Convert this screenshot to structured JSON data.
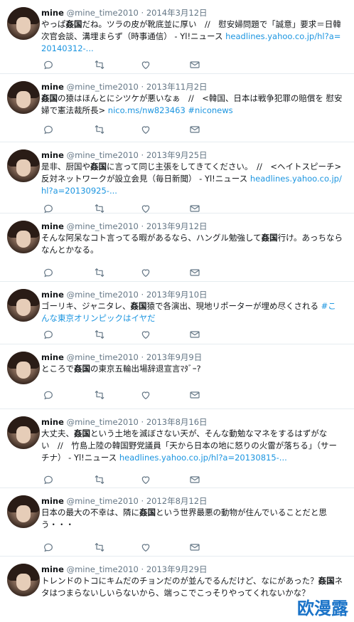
{
  "account": {
    "name": "mine",
    "handle": "@mine_time2010"
  },
  "tweets": [
    {
      "date": "2014年3月12日",
      "segments": [
        {
          "t": "やっぱ"
        },
        {
          "t": "姦国",
          "b": true
        },
        {
          "t": "だね。ツラの皮が靴底並に厚い　//　慰安婦問題で「誠意」要求＝日韓次官会談、溝埋まらず（時事通信） - Yl!ニュース "
        },
        {
          "t": "headlines.yahoo.co.jp/hl?a=20140312-...",
          "link": true
        }
      ]
    },
    {
      "date": "2013年11月2日",
      "segments": [
        {
          "t": "姦国",
          "b": true
        },
        {
          "t": "の猿はほんとにシツケが悪いなぁ　//　<韓国、日本は戦争犯罪の賠償を 慰安婦で憲法裁所長> "
        },
        {
          "t": "nico.ms/nw823463 #niconews",
          "link": true
        }
      ]
    },
    {
      "date": "2013年9月25日",
      "segments": [
        {
          "t": "是非、厨国や"
        },
        {
          "t": "姦国",
          "b": true
        },
        {
          "t": "に言って同じ主張をしてきてください。　//　<ヘイトスピーチ> 反対ネットワークが設立会見（毎日新聞） - Yl!ニュース "
        },
        {
          "t": "headlines.yahoo.co.jp/hl?a=20130925-...",
          "link": true
        }
      ]
    },
    {
      "date": "2013年9月12日",
      "segments": [
        {
          "t": "そんな阿呆なコト言ってる暇があるなら、ハングル勉強して"
        },
        {
          "t": "姦国",
          "b": true
        },
        {
          "t": "行け。あっちならなんとかなる。"
        }
      ]
    },
    {
      "date": "2013年9月10日",
      "segments": [
        {
          "t": "ゴーリキ、ジャニタレ、"
        },
        {
          "t": "姦国",
          "b": true
        },
        {
          "t": "猿で各演出、現地リポーターが埋め尽くされる "
        },
        {
          "t": "#こんな東京オリンピックはイヤだ",
          "link": true
        }
      ]
    },
    {
      "date": "2013年9月9日",
      "segments": [
        {
          "t": "ところで"
        },
        {
          "t": "姦国",
          "b": true
        },
        {
          "t": "の東京五輪出場辞退宣言ﾏﾀﾞｰ?"
        }
      ]
    },
    {
      "date": "2013年8月16日",
      "segments": [
        {
          "t": "大丈夫、"
        },
        {
          "t": "姦国",
          "b": true
        },
        {
          "t": "という土地を滅ぼさない天が、そんな動勉なマネをするはずがない　//　竹島上陸の韓国野党議員「天から日本の地に怒りの火雷が落ちる」（サーチナ） - Yl!ニュース "
        },
        {
          "t": "headlines.yahoo.co.jp/hl?a=20130815-...",
          "link": true
        }
      ]
    },
    {
      "date": "2012年8月12日",
      "segments": [
        {
          "t": "日本の最大の不幸は、隣に"
        },
        {
          "t": "姦国",
          "b": true
        },
        {
          "t": "という世界最悪の動物が住んでいることだと思う・・・"
        }
      ]
    },
    {
      "date": "2013年9月29日",
      "segments": [
        {
          "t": "トレンドのトコにキムだのチョンだのが並んでるんだけど、なにがあった？"
        },
        {
          "t": "姦国",
          "b": true
        },
        {
          "t": "ネタはつまらないしいらないから、端っこでこっそりやってくれないかな？"
        }
      ]
    }
  ],
  "dot": "·",
  "watermark": "欧漫露",
  "icons": [
    "reply-icon",
    "retweet-icon",
    "like-icon",
    "message-icon"
  ],
  "colors": {
    "link": "#1b95e0",
    "meta": "#657786",
    "icon": "#657786",
    "border": "#e6ecf0",
    "watermark": "#1a73c8"
  }
}
